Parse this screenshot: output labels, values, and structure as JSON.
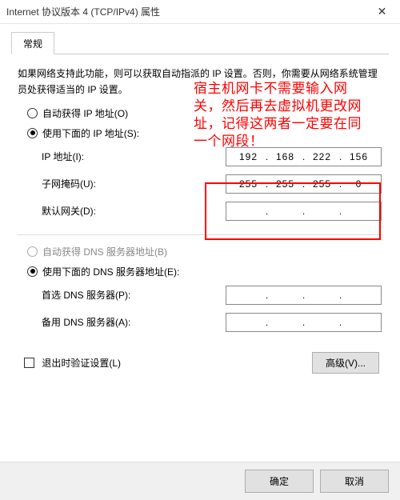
{
  "window": {
    "title": "Internet 协议版本 4 (TCP/IPv4) 属性"
  },
  "tab": {
    "general": "常规"
  },
  "desc": "如果网络支持此功能，则可以获取自动指派的 IP 设置。否则，你需要从网络系统管理员处获得适当的 IP 设置。",
  "annotation": "宿主机网卡不需要输入网关，然后再去虚拟机更改网址，记得这两者一定要在同一个网段！",
  "ip": {
    "radio_auto": "自动获得 IP 地址(O)",
    "radio_manual": "使用下面的 IP 地址(S):",
    "label_ip": "IP 地址(I):",
    "label_mask": "子网掩码(U):",
    "label_gw": "默认网关(D):",
    "addr": {
      "a": "192",
      "b": "168",
      "c": "222",
      "d": "156"
    },
    "mask": {
      "a": "255",
      "b": "255",
      "c": "255",
      "d": "0"
    },
    "gw": {
      "a": "",
      "b": "",
      "c": "",
      "d": ""
    }
  },
  "dns": {
    "radio_auto": "自动获得 DNS 服务器地址(B)",
    "radio_manual": "使用下面的 DNS 服务器地址(E):",
    "label_pref": "首选 DNS 服务器(P):",
    "label_alt": "备用 DNS 服务器(A):",
    "pref": {
      "a": "",
      "b": "",
      "c": "",
      "d": ""
    },
    "alt": {
      "a": "",
      "b": "",
      "c": "",
      "d": ""
    }
  },
  "validate_label": "退出时验证设置(L)",
  "buttons": {
    "advanced": "高级(V)...",
    "ok": "确定",
    "cancel": "取消"
  },
  "glyph": {
    "dot": ".",
    "close": "✕"
  }
}
